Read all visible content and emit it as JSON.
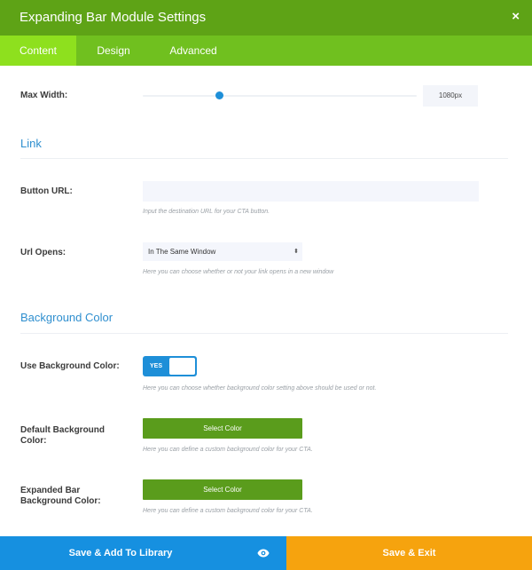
{
  "header": {
    "title": "Expanding Bar Module Settings",
    "close_symbol": "×"
  },
  "tabs": [
    {
      "label": "Content",
      "active": true
    },
    {
      "label": "Design",
      "active": false
    },
    {
      "label": "Advanced",
      "active": false
    }
  ],
  "max_width": {
    "label": "Max Width:",
    "value": "1080px",
    "slider_fraction": 0.28
  },
  "link_section": {
    "title": "Link"
  },
  "button_url": {
    "label": "Button URL:",
    "value": "",
    "description": "Input the destination URL for your CTA button."
  },
  "url_opens": {
    "label": "Url Opens:",
    "selected": "In The Same Window",
    "arrows": "⬍",
    "description": "Here you can choose whether or not your link opens in a new window"
  },
  "background_section": {
    "title": "Background Color"
  },
  "use_bg_color": {
    "label": "Use Background Color:",
    "toggle_label": "YES",
    "on": true,
    "description": "Here you can choose whether background color setting above should be used or not."
  },
  "default_bg_color": {
    "label_line1": "Default Background",
    "label_line2": "Color:",
    "button_label": "Select Color",
    "description": "Here you can define a custom background color for your CTA."
  },
  "expanded_bg_color": {
    "label_line1": "Expanded Bar",
    "label_line2": "Background Color:",
    "button_label": "Select Color",
    "description": "Here you can define a custom background color for your CTA."
  },
  "footer": {
    "save_library_label": "Save & Add To Library",
    "save_exit_label": "Save & Exit"
  },
  "colors": {
    "header": "#5ea316",
    "tabs": "#70c01f",
    "active_tab": "#8ee01e",
    "accent_blue": "#1e8fd8",
    "select_color_button": "#5a9c1c",
    "save_exit": "#f6a30e",
    "save_library": "#1690e0"
  }
}
